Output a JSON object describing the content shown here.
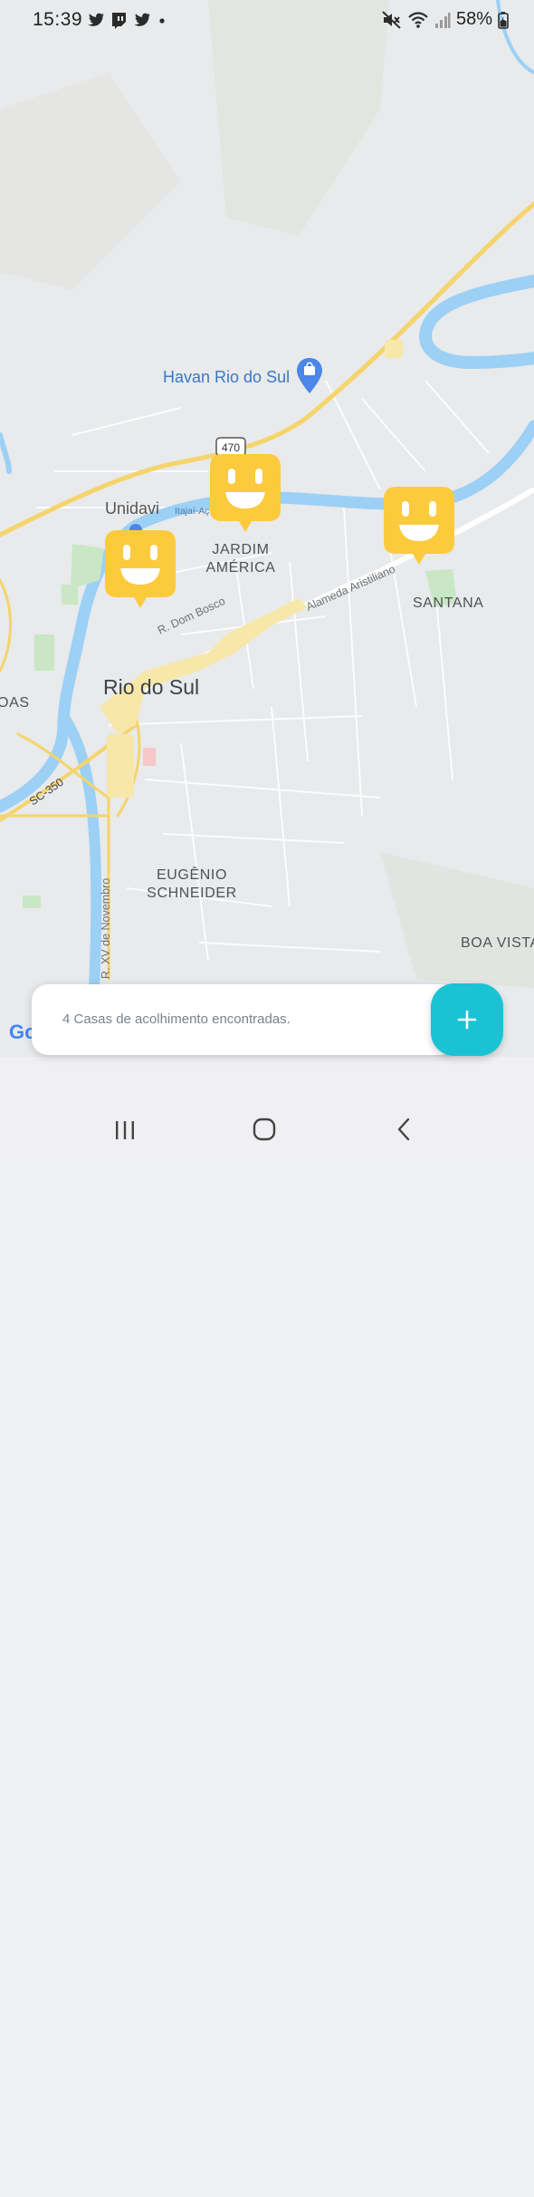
{
  "status_bar": {
    "time": "15:39",
    "battery": "58%",
    "left_icons": [
      "twitter-icon",
      "twitch-icon",
      "twitter-icon",
      "dot-icon"
    ],
    "right_icons": [
      "mute-icon",
      "wifi-icon",
      "signal-icon",
      "battery-icon"
    ]
  },
  "map": {
    "labels": {
      "havan": "Havan Rio do Sul",
      "route470": "470",
      "unidavi": "Unidavi",
      "itajai": "Itajaí-Aç",
      "jardim_america_1": "JARDIM",
      "jardim_america_2": "AMÉRICA",
      "santana": "SANTANA",
      "dom_bosco": "R. Dom Bosco",
      "alameda": "Alameda Aristiliano",
      "rio_do_sul": "Rio do Sul",
      "oas": "IOAS",
      "sc350": "SC-350",
      "xv_novembro": "R. XV de Novembro",
      "eugenio_1": "EUGÊNIO",
      "eugenio_2": "SCHNEIDER",
      "boa_vista": "BOA VISTA",
      "google": "Go"
    },
    "markers": [
      "smile-marker",
      "smile-marker",
      "smile-marker"
    ],
    "colors": {
      "marker": "#fcca3d",
      "river": "#9cd0f5",
      "highway": "#f5d46b",
      "urban": "#f7e7a9"
    }
  },
  "result_card": {
    "text": "4 Casas de acolhimento encontradas."
  },
  "fab": {
    "icon": "plus-icon",
    "color": "#19c3d3"
  },
  "nav": {
    "recents": "recents-icon",
    "home": "home-icon",
    "back": "back-icon"
  }
}
